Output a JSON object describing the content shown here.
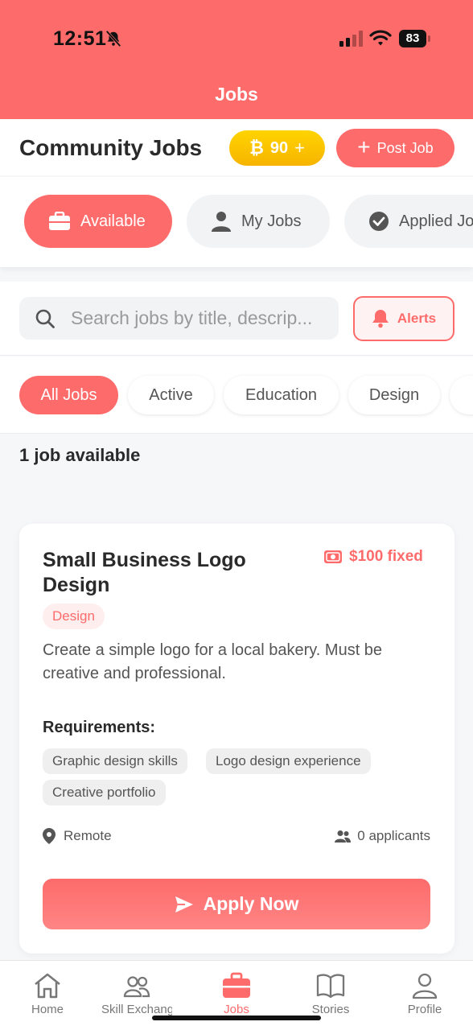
{
  "status_bar": {
    "time": "12:51",
    "battery": "83"
  },
  "header": {
    "title": "Jobs"
  },
  "title_row": {
    "heading": "Community Jobs",
    "coins": "90",
    "post_job": "Post Job"
  },
  "tabs": [
    {
      "label": "Available",
      "icon": "briefcase-icon",
      "active": true
    },
    {
      "label": "My Jobs",
      "icon": "person-icon",
      "active": false
    },
    {
      "label": "Applied Jobs",
      "icon": "check-circle-icon",
      "active": false
    }
  ],
  "search": {
    "placeholder": "Search jobs by title, descrip...",
    "alerts_label": "Alerts"
  },
  "filters": [
    "All Jobs",
    "Active",
    "Education",
    "Design"
  ],
  "job_count": "1 job available",
  "job": {
    "title": "Small Business Logo Design",
    "pay": "$100 fixed",
    "category": "Design",
    "description": "Create a simple logo for a local bakery. Must be creative and professional.",
    "requirements_label": "Requirements:",
    "requirements": [
      "Graphic design skills",
      "Logo design experience",
      "Creative portfolio"
    ],
    "location": "Remote",
    "applicants": "0 applicants",
    "apply_label": "Apply Now"
  },
  "bottom_nav": [
    {
      "label": "Home",
      "icon": "home-icon",
      "active": false
    },
    {
      "label": "Skill Exchange",
      "icon": "users-icon",
      "active": false
    },
    {
      "label": "Jobs",
      "icon": "briefcase-icon",
      "active": true
    },
    {
      "label": "Stories",
      "icon": "book-icon",
      "active": false
    },
    {
      "label": "Profile",
      "icon": "person-icon",
      "active": false
    }
  ],
  "colors": {
    "accent": "#fd6b6b",
    "coin": "#f7b400",
    "background": "#f6f7f9"
  }
}
